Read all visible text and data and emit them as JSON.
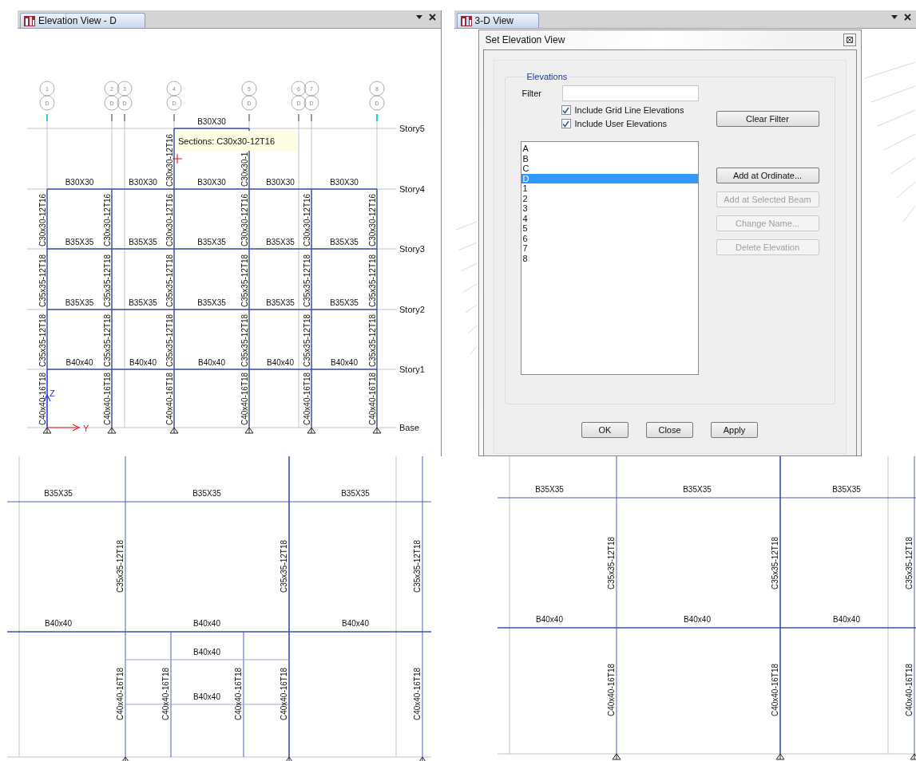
{
  "elevation_view": {
    "tab": "Elevation View - D",
    "grids": [
      {
        "label": "1",
        "line": "D",
        "highlighted": true
      },
      {
        "label": "2",
        "line": "D",
        "highlighted": false
      },
      {
        "label": "3",
        "line": "D",
        "highlighted": false
      },
      {
        "label": "4",
        "line": "D",
        "highlighted": false
      },
      {
        "label": "5",
        "line": "D",
        "highlighted": false
      },
      {
        "label": "6",
        "line": "D",
        "highlighted": false
      },
      {
        "label": "7",
        "line": "D",
        "highlighted": false
      },
      {
        "label": "8",
        "line": "D",
        "highlighted": true
      }
    ],
    "stories": [
      {
        "name": "Story5",
        "beams": [
          "B30X30"
        ],
        "columns": [
          "C30x30-12T16",
          "C30x30-1"
        ]
      },
      {
        "name": "Story4",
        "beams": [
          "B30X30",
          "B30X30",
          "B30X30",
          "B30X30",
          "B30X30"
        ],
        "columns": [
          "C30x30-12T16",
          "C30x30-12T16",
          "C30x30-12T16",
          "C30x30-12T16",
          "C30x30-12T16",
          "C30x30-12T16"
        ]
      },
      {
        "name": "Story3",
        "beams": [
          "B35X35",
          "B35X35",
          "B35X35",
          "B35X35",
          "B35X35"
        ],
        "columns": [
          "C35x35-12T18",
          "C35x35-12T18",
          "C35x35-12T18",
          "C35x35-12T18",
          "C35x35-12T18",
          "C35x35-12T18"
        ]
      },
      {
        "name": "Story2",
        "beams": [
          "B35X35",
          "B35X35",
          "B35X35",
          "B35X35",
          "B35X35"
        ],
        "columns": [
          "C35x35-12T18",
          "C35x35-12T18",
          "C35x35-12T18",
          "C35x35-12T18",
          "C35x35-12T18",
          "C35x35-12T18"
        ]
      },
      {
        "name": "Story1",
        "beams": [
          "B40x40",
          "B40x40",
          "B40x40",
          "B40x40",
          "B40x40"
        ],
        "columns": [
          "C40x40-16T18",
          "C40x40-16T18",
          "C40x40-16T18",
          "C40x40-16T18",
          "C40x40-16T18",
          "C40x40-16T18"
        ]
      },
      {
        "name": "Base"
      }
    ],
    "tooltip": "Sections: C30x30-12T16",
    "axes": {
      "z": "Z",
      "y": "Y"
    }
  },
  "view_3d": {
    "tab": "3-D View",
    "dialog": {
      "title": "Set Elevation View",
      "group": "Elevations",
      "filter_label": "Filter",
      "checkboxes": [
        {
          "label": "Include Grid Line Elevations",
          "checked": true
        },
        {
          "label": "Include User Elevations",
          "checked": true
        }
      ],
      "clear_button": "Clear Filter",
      "elevations": [
        {
          "label": "A",
          "selected": false
        },
        {
          "label": "B",
          "selected": false
        },
        {
          "label": "C",
          "selected": false
        },
        {
          "label": "D",
          "selected": true
        },
        {
          "label": "1",
          "selected": false
        },
        {
          "label": "2",
          "selected": false
        },
        {
          "label": "3",
          "selected": false
        },
        {
          "label": "4",
          "selected": false
        },
        {
          "label": "5",
          "selected": false
        },
        {
          "label": "6",
          "selected": false
        },
        {
          "label": "7",
          "selected": false
        },
        {
          "label": "8",
          "selected": false
        }
      ],
      "actions": [
        {
          "label": "Add at Ordinate...",
          "disabled": false
        },
        {
          "label": "Add at Selected Beam",
          "disabled": true
        },
        {
          "label": "Change Name...",
          "disabled": true
        },
        {
          "label": "Delete Elevation",
          "disabled": true
        }
      ],
      "footer": [
        "OK",
        "Close",
        "Apply"
      ]
    }
  },
  "detail_left": {
    "upper_beams": [
      "B35X35",
      "B35X35",
      "B35X35"
    ],
    "upper_columns": [
      "C35x35-12T18",
      "C35x35-12T18",
      "C35x35-12T18"
    ],
    "lower_beams": [
      "B40x40",
      "B40x40",
      "B40x40"
    ],
    "infill_beams": [
      "B40x40",
      "B40x40"
    ],
    "lower_columns": [
      "C40x40-16T18",
      "C40x40-16T18",
      "C40x40-16T18",
      "C40x40-16T18",
      "C40x40-16T18"
    ]
  },
  "detail_right": {
    "upper_beams": [
      "B35X35",
      "B35X35",
      "B35X35"
    ],
    "upper_columns": [
      "C35x35-12T18",
      "C35x35-12T18",
      "C35x35-12T18"
    ],
    "lower_beams": [
      "B40x40",
      "B40x40",
      "B40x40"
    ],
    "lower_columns": [
      "C40x40-16T18",
      "C40x40-16T18",
      "C40x40-16T18"
    ]
  }
}
